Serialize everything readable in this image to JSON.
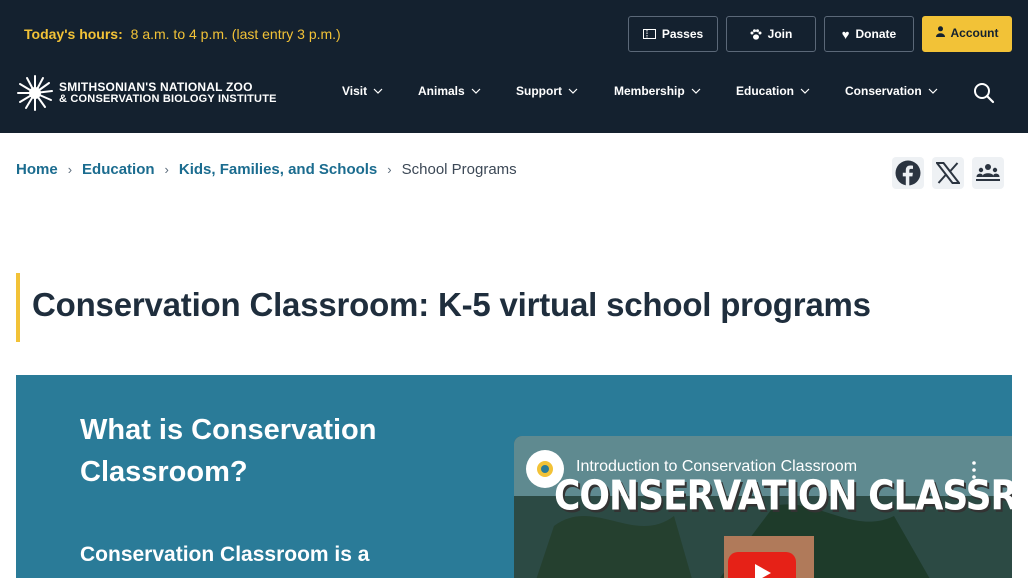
{
  "header": {
    "hours_label": "Today's hours:",
    "hours_value": "8 a.m. to 4  p.m. (last entry 3 p.m.)",
    "buttons": {
      "passes": "Passes",
      "join": "Join",
      "donate": "Donate",
      "account": "Account"
    },
    "logo_line1": "SMITHSONIAN'S NATIONAL ZOO",
    "logo_line2": "& CONSERVATION BIOLOGY INSTITUTE",
    "nav": [
      "Visit",
      "Animals",
      "Support",
      "Membership",
      "Education",
      "Conservation"
    ],
    "colors": {
      "background": "#14212f",
      "accent": "#f2c237"
    }
  },
  "breadcrumb": {
    "items": [
      "Home",
      "Education",
      "Kids, Families, and Schools"
    ],
    "current": "School Programs"
  },
  "share": [
    "facebook-icon",
    "x-icon",
    "share-icon"
  ],
  "page_title": "Conservation Classroom: K-5 virtual school programs",
  "feature": {
    "heading": "What is Conservation Classroom?",
    "body": "Conservation Classroom is a",
    "band_color": "#2a7b98",
    "video": {
      "title": "Introduction to Conservation Classroom",
      "banner": "CONSERVATION CLASSROOM"
    }
  }
}
